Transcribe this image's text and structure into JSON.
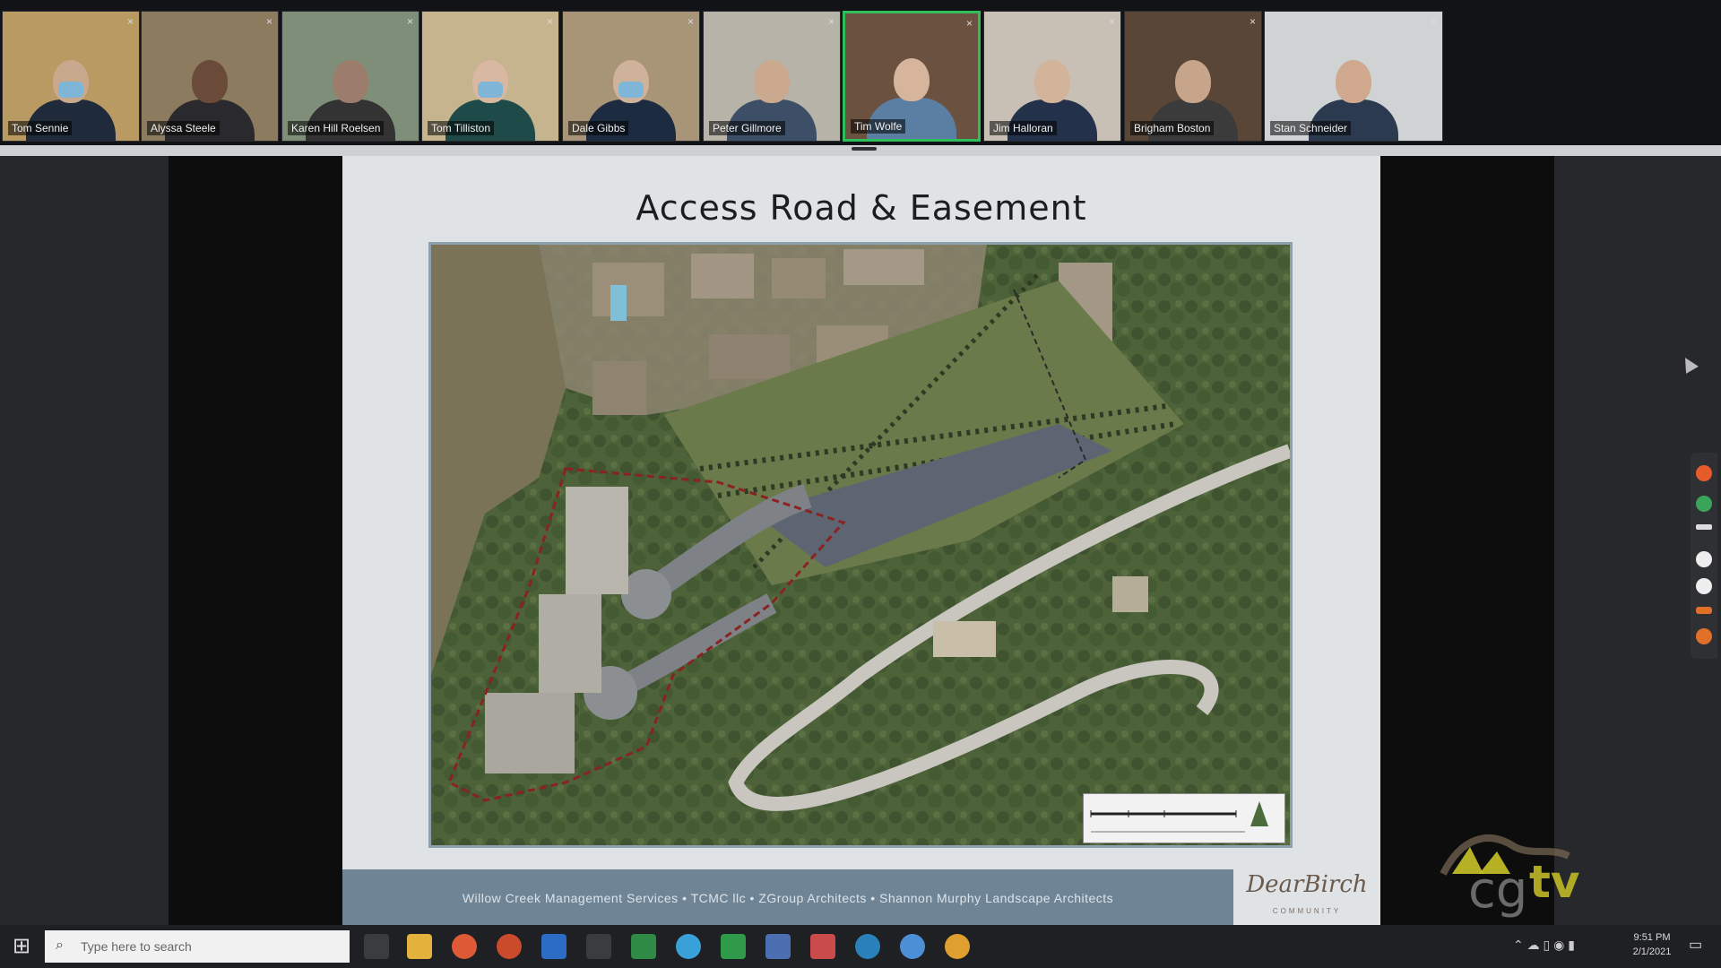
{
  "participants": [
    {
      "name": "Tom Sennie",
      "bg": "#b99a63",
      "skin": "#c9a98e",
      "shirt": "#1f2a3b",
      "mask": true
    },
    {
      "name": "Alyssa Steele",
      "bg": "#8d7b60",
      "skin": "#6a4a38",
      "shirt": "#2a2a2e",
      "mask": false
    },
    {
      "name": "Karen Hill Roelsen",
      "bg": "#7f8e79",
      "skin": "#9c7c6a",
      "shirt": "#333",
      "mask": false
    },
    {
      "name": "Tom Tilliston",
      "bg": "#c6b48f",
      "skin": "#d8b8a0",
      "shirt": "#1f4a4a",
      "mask": true
    },
    {
      "name": "Dale Gibbs",
      "bg": "#a89577",
      "skin": "#cfb29c",
      "shirt": "#1d2b40",
      "mask": true
    },
    {
      "name": "Peter Gillmore",
      "bg": "#b8b3a8",
      "skin": "#cba98f",
      "shirt": "#3d4f66",
      "mask": false
    },
    {
      "name": "Tim Wolfe",
      "bg": "#6a5140",
      "skin": "#d7b59d",
      "shirt": "#5b7ea3",
      "mask": false
    },
    {
      "name": "Jim Halloran",
      "bg": "#c8c0b4",
      "skin": "#d3b39a",
      "shirt": "#23324a",
      "mask": false
    },
    {
      "name": "Brigham Boston",
      "bg": "#5a4636",
      "skin": "#c7a58b",
      "shirt": "#3b3b3b",
      "mask": false
    },
    {
      "name": "Stan Schneider",
      "bg": "#cfd3d4",
      "skin": "#cfa88d",
      "shirt": "#2c3a4f",
      "mask": false
    }
  ],
  "active_participant_index": 6,
  "slide": {
    "title": "Access Road & Easement",
    "footer": "Willow Creek Management Services  •  TCMC llc  •  ZGroup Architects  •  Shannon Murphy Landscape Architects",
    "brand_signature": "DearBirch",
    "brand_sub": "COMMUNITY"
  },
  "watermark": {
    "text_left": "cg",
    "text_right": "tv"
  },
  "taskbar": {
    "search_placeholder": "Type here to search",
    "clock_time": "9:51 PM",
    "clock_date": "2/1/2021"
  },
  "colors": {
    "active_border": "#2fbf5a",
    "slide_bg": "#dfe3e5",
    "footer_band": "#6f8596"
  }
}
